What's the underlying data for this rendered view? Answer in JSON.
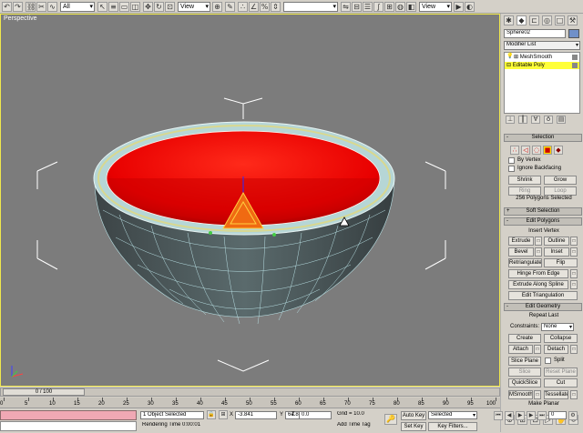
{
  "toolbar": {
    "selection_filter": "All",
    "coord_system_1": "View",
    "coord_system_2": "View",
    "named_selection": ""
  },
  "viewport": {
    "label": "Perspective"
  },
  "command_panel": {
    "object_name": "Sphere02",
    "modifier_list_label": "Modifier List",
    "stack": [
      {
        "label": "MeshSmooth",
        "selected": false
      },
      {
        "label": "Editable Poly",
        "selected": true
      }
    ],
    "selection_rollout": {
      "title": "Selection",
      "by_vertex": "By Vertex",
      "ignore_backfacing": "Ignore Backfacing",
      "shrink": "Shrink",
      "grow": "Grow",
      "ring": "Ring",
      "loop": "Loop",
      "status": "256 Polygons Selected"
    },
    "soft_selection_title": "Soft Selection",
    "edit_polygons": {
      "title": "Edit Polygons",
      "insert_vertex": "Insert Vertex",
      "extrude": "Extrude",
      "outline": "Outline",
      "bevel": "Bevel",
      "inset": "Inset",
      "retriangulate": "Retriangulate",
      "flip": "Flip",
      "hinge_from_edge": "Hinge From Edge",
      "extrude_along_spline": "Extrude Along Spline",
      "edit_triangulation": "Edit Triangulation"
    },
    "edit_geometry": {
      "title": "Edit Geometry",
      "repeat_last": "Repeat Last",
      "constraints_label": "Constraints:",
      "constraints_value": "None",
      "create": "Create",
      "collapse": "Collapse",
      "attach": "Attach",
      "detach": "Detach",
      "slice_plane": "Slice Plane",
      "split": "Split",
      "slice": "Slice",
      "reset_plane": "Reset Plane",
      "quickslice": "QuickSlice",
      "cut": "Cut",
      "msmooth": "MSmooth",
      "tessellate": "Tessellate",
      "make_planar": "Make Planar"
    }
  },
  "timeline": {
    "frame_counter": "0 / 100",
    "ticks": [
      "0",
      "5",
      "10",
      "15",
      "20",
      "25",
      "30",
      "35",
      "40",
      "45",
      "50",
      "55",
      "60",
      "65",
      "70",
      "75",
      "80",
      "85",
      "90",
      "95",
      "100"
    ]
  },
  "status_bar": {
    "selection_status": "1 Object Selected",
    "render_time": "Rendering Time  0:00:01",
    "x_label": "X",
    "x_value": "-3.841",
    "y_label": "Y",
    "y_value": "64.885",
    "z_label": "Z",
    "z_value": "0.0",
    "grid": "Grid = 10.0",
    "add_time_tag": "Add Time Tag",
    "auto_key": "Auto Key",
    "auto_key_mode": "Selected",
    "set_key": "Set Key",
    "key_filters": "Key Filters...",
    "current_frame": "0"
  }
}
